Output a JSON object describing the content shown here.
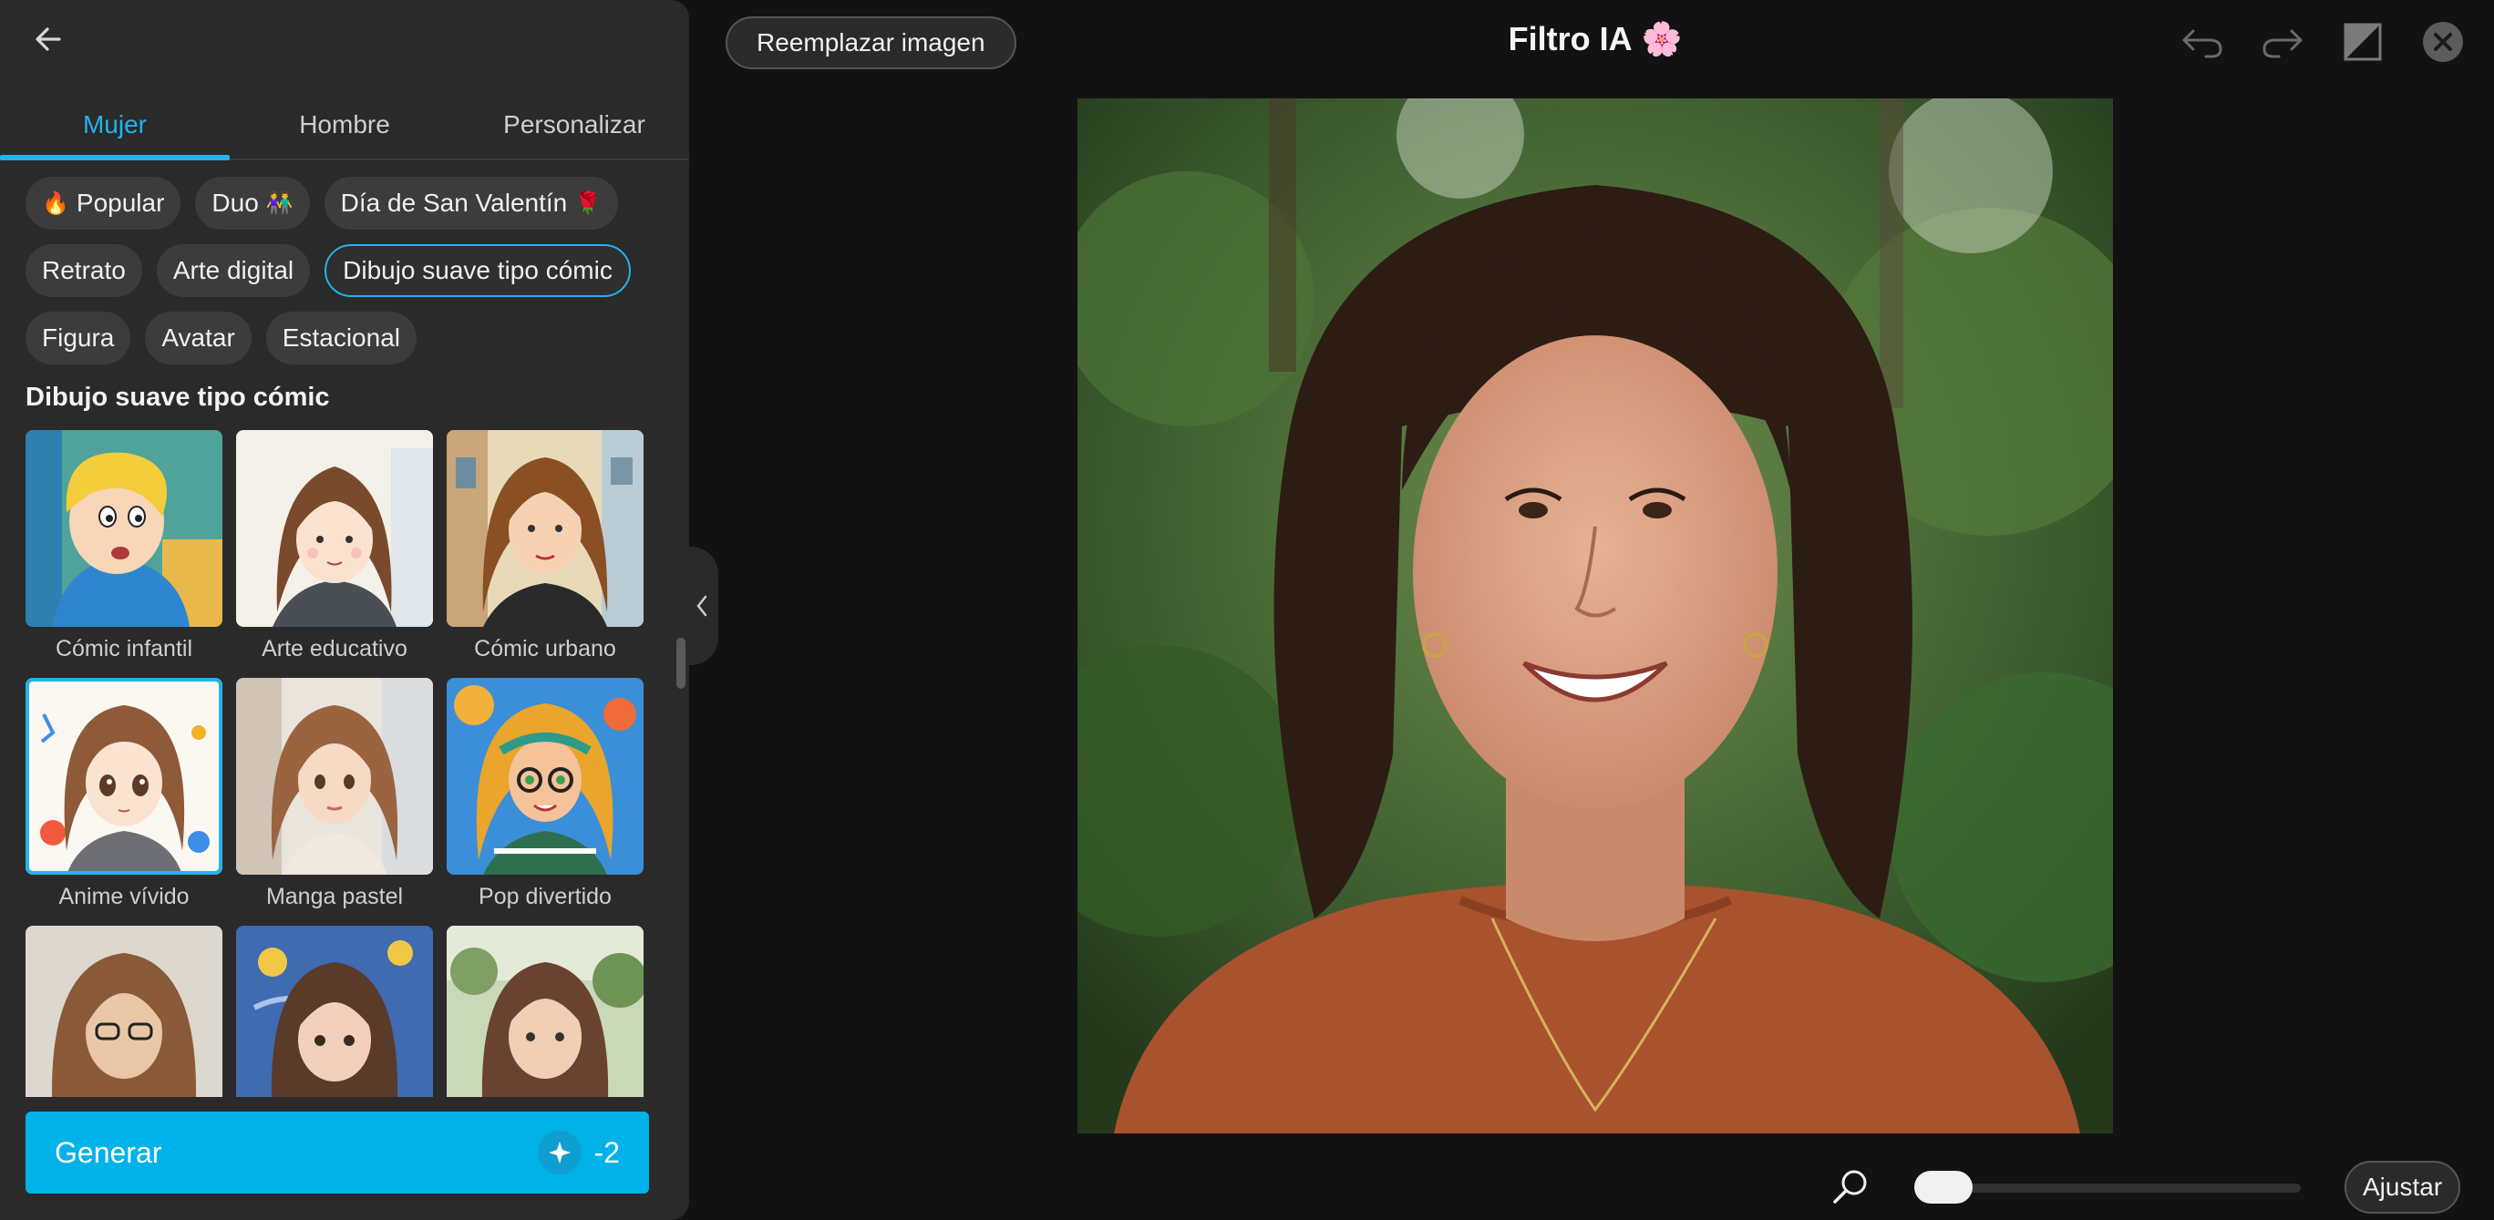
{
  "header": {
    "replace_label": "Reemplazar imagen",
    "title": "Filtro IA",
    "title_emoji": "🌸"
  },
  "tabs": [
    {
      "label": "Mujer",
      "active": true
    },
    {
      "label": "Hombre",
      "active": false
    },
    {
      "label": "Personalizar",
      "active": false
    }
  ],
  "chips": [
    {
      "emoji": "🔥",
      "label": "Popular"
    },
    {
      "emoji": "",
      "label": "Duo",
      "suffix": "👫"
    },
    {
      "emoji": "",
      "label": "Día de San Valentín",
      "suffix": "🌹"
    },
    {
      "emoji": "",
      "label": "Retrato"
    },
    {
      "emoji": "",
      "label": "Arte digital"
    },
    {
      "emoji": "",
      "label": "Dibujo suave tipo cómic",
      "selected": true
    },
    {
      "emoji": "",
      "label": "Figura"
    },
    {
      "emoji": "",
      "label": "Avatar"
    },
    {
      "emoji": "",
      "label": "Estacional"
    }
  ],
  "section_title": "Dibujo suave tipo cómic",
  "styles": [
    {
      "label": "Cómic infantil"
    },
    {
      "label": "Arte educativo"
    },
    {
      "label": "Cómic urbano"
    },
    {
      "label": "Anime vívido",
      "selected": true
    },
    {
      "label": "Manga pastel"
    },
    {
      "label": "Pop divertido"
    },
    {
      "label": ""
    },
    {
      "label": ""
    },
    {
      "label": ""
    }
  ],
  "generate": {
    "label": "Generar",
    "cost": "-2"
  },
  "bottom": {
    "fit_label": "Ajustar",
    "zoom_level": 0.0
  },
  "colors": {
    "accent": "#22b4ee",
    "generate_bg": "#00b2e8",
    "panel_bg": "#2a2a2a",
    "canvas_bg": "#121212"
  }
}
